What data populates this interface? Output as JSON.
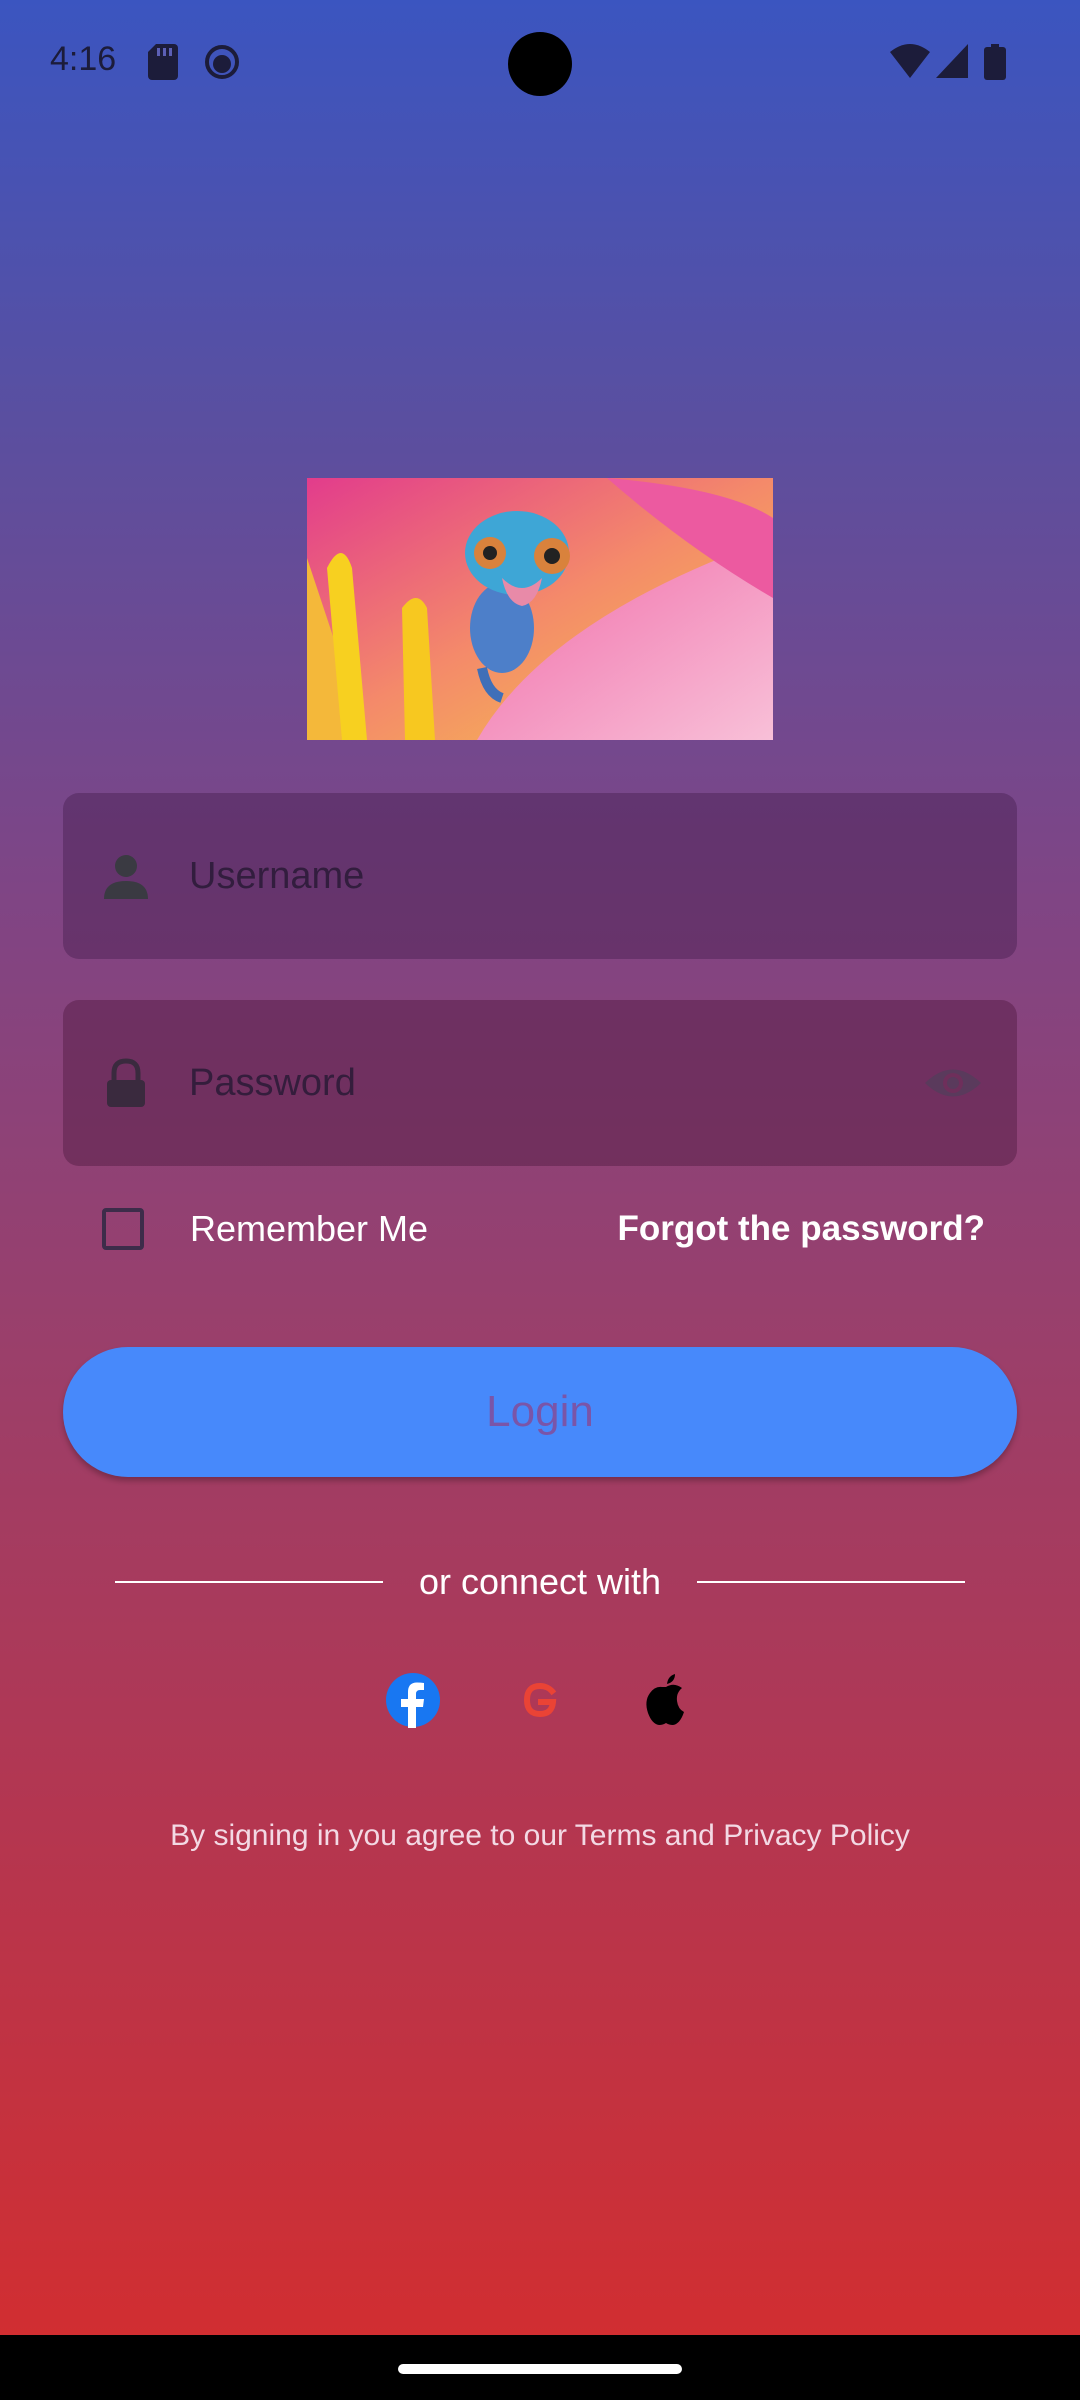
{
  "status_bar": {
    "time": "4:16",
    "left_icons": [
      "sd-card-icon",
      "notification-face-icon"
    ],
    "right_icons": [
      "wifi-icon",
      "cell-signal-icon",
      "battery-icon"
    ]
  },
  "hero": {
    "image_description_icon": "chameleon-on-flower-image"
  },
  "form": {
    "username_placeholder": "Username",
    "password_placeholder": "Password",
    "remember_label": "Remember Me",
    "forgot_label": "Forgot the password?",
    "login_label": "Login"
  },
  "social": {
    "divider_text": "or connect with",
    "providers": [
      "facebook-icon",
      "google-icon",
      "apple-icon"
    ]
  },
  "terms_text": "By signing in you agree to our Terms and Privacy Policy",
  "colors": {
    "gradient_top": "#3b55c0",
    "gradient_bottom": "#d12e31",
    "login_button": "#4789fb",
    "facebook": "#1877f2",
    "google": "#ea4335"
  }
}
